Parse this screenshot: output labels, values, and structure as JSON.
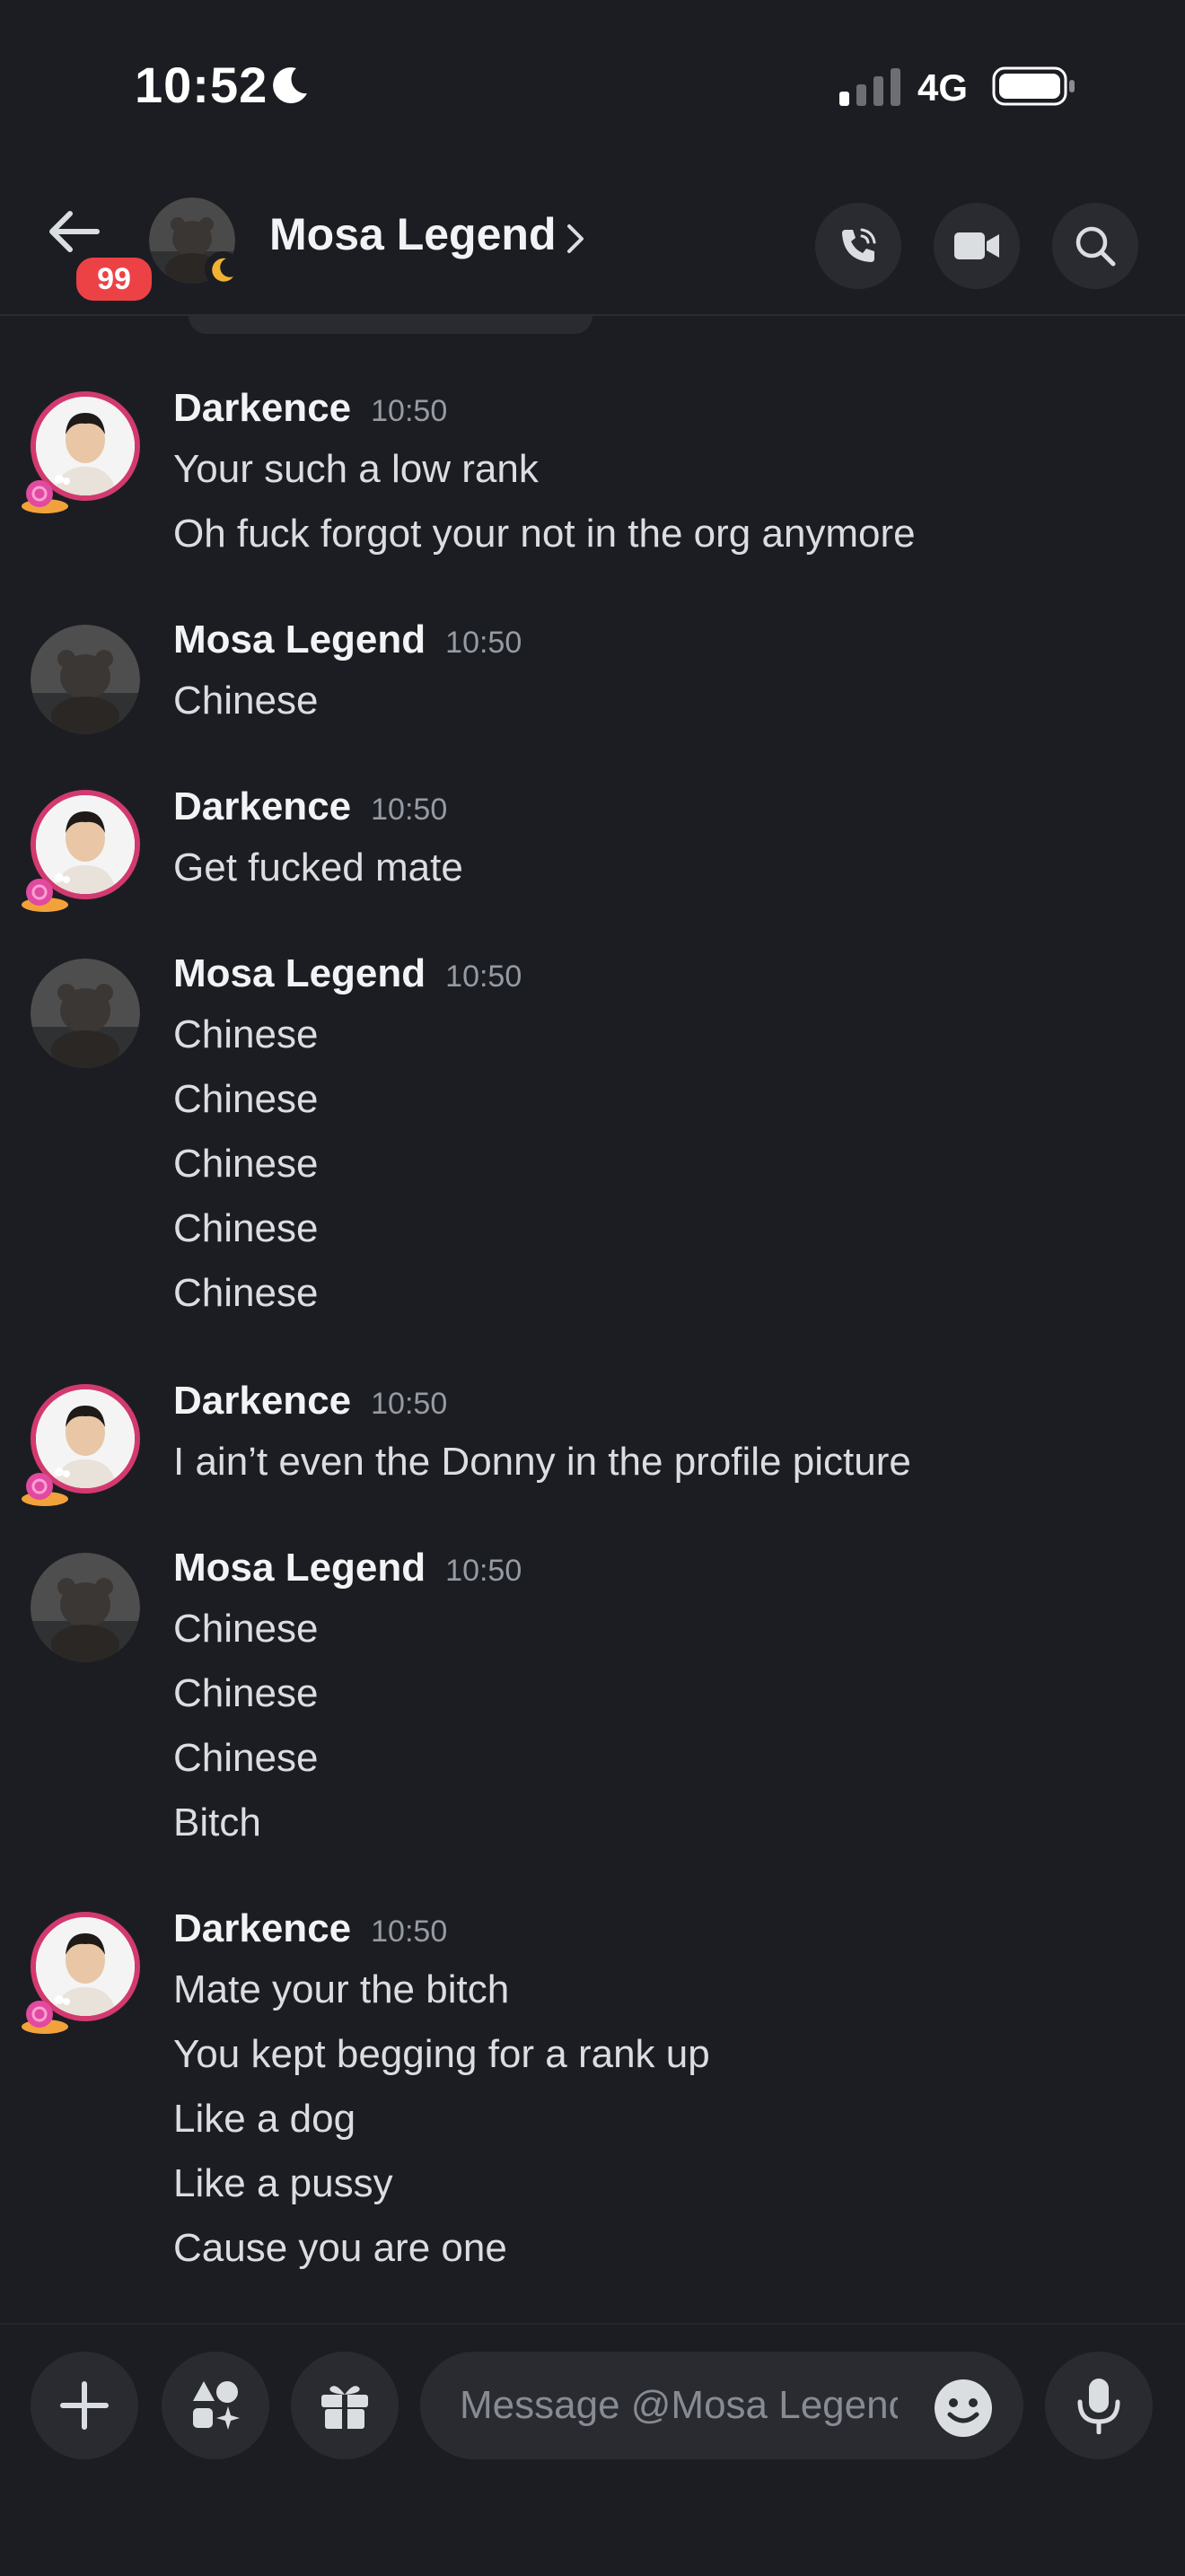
{
  "status": {
    "time": "10:52",
    "network": "4G"
  },
  "header": {
    "name": "Mosa Legend",
    "badge": "99"
  },
  "composer": {
    "placeholder": "Message @Mosa Legend"
  },
  "messages": [
    {
      "author": "Darkence",
      "time": "10:50",
      "lines": [
        "Your such a low rank",
        "Oh fuck forgot your not in the org anymore"
      ]
    },
    {
      "author": "Mosa Legend",
      "time": "10:50",
      "lines": [
        "Chinese"
      ]
    },
    {
      "author": "Darkence",
      "time": "10:50",
      "lines": [
        "Get fucked mate"
      ]
    },
    {
      "author": "Mosa Legend",
      "time": "10:50",
      "lines": [
        "Chinese",
        "Chinese",
        "Chinese",
        "Chinese",
        "Chinese"
      ]
    },
    {
      "author": "Darkence",
      "time": "10:50",
      "lines": [
        "I ain’t even the Donny in the profile picture"
      ]
    },
    {
      "author": "Mosa Legend",
      "time": "10:50",
      "lines": [
        "Chinese",
        "Chinese",
        "Chinese",
        "Bitch"
      ]
    },
    {
      "author": "Darkence",
      "time": "10:50",
      "lines": [
        "Mate your the bitch",
        "You kept begging for a rank up",
        "Like a dog",
        "Like a pussy",
        "Cause you are one"
      ]
    }
  ],
  "icons": {
    "back": "arrow-left-icon",
    "call": "phone-icon",
    "video": "video-camera-icon",
    "search": "search-icon",
    "plus": "plus-icon",
    "apps": "apps-icon",
    "gift": "gift-icon",
    "emoji": "emoji-icon",
    "mic": "microphone-icon"
  },
  "colors": {
    "background": "#1c1d22",
    "badge": "#ed4245",
    "surface": "#2a2b31"
  }
}
